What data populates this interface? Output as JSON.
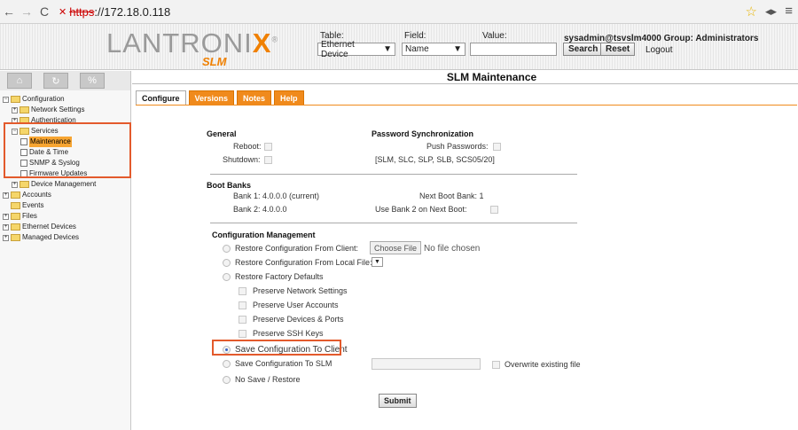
{
  "browser": {
    "scheme": "https",
    "host": "://172.18.0.118"
  },
  "header": {
    "logo_text": "LANTRONI",
    "logo_x": "X",
    "logo_reg": "®",
    "logo_sub": "SLM",
    "table_label": "Table:",
    "table_value": "Ethernet Device",
    "field_label": "Field:",
    "field_value": "Name",
    "value_label": "Value:",
    "search_label": "Search",
    "reset_label": "Reset",
    "user_text": "sysadmin@tsvslm4000   Group: Administrators",
    "logout_label": "Logout"
  },
  "sidebar": {
    "tree": [
      {
        "label": "Configuration",
        "level": 0,
        "type": "folder",
        "pm": "−"
      },
      {
        "label": "Network Settings",
        "level": 1,
        "type": "folder",
        "pm": "+"
      },
      {
        "label": "Authentication",
        "level": 1,
        "type": "folder",
        "pm": "+"
      },
      {
        "label": "Services",
        "level": 1,
        "type": "folder",
        "pm": "−"
      },
      {
        "label": "Maintenance",
        "level": 2,
        "type": "doc",
        "selected": true
      },
      {
        "label": "Date & Time",
        "level": 2,
        "type": "doc"
      },
      {
        "label": "SNMP & Syslog",
        "level": 2,
        "type": "doc"
      },
      {
        "label": "Firmware Updates",
        "level": 2,
        "type": "doc"
      },
      {
        "label": "Device Management",
        "level": 1,
        "type": "folder",
        "pm": "+"
      },
      {
        "label": "Accounts",
        "level": 0,
        "type": "folder",
        "pm": "+"
      },
      {
        "label": "Events",
        "level": 0,
        "type": "folder",
        "pm": ""
      },
      {
        "label": "Files",
        "level": 0,
        "type": "folder",
        "pm": "+"
      },
      {
        "label": "Ethernet Devices",
        "level": 0,
        "type": "folder",
        "pm": "+"
      },
      {
        "label": "Managed Devices",
        "level": 0,
        "type": "folder",
        "pm": "+"
      }
    ]
  },
  "main": {
    "title": "SLM Maintenance",
    "tabs": [
      "Configure",
      "Versions",
      "Notes",
      "Help"
    ],
    "general": {
      "heading": "General",
      "reboot": "Reboot:",
      "shutdown": "Shutdown:"
    },
    "password": {
      "heading": "Password Synchronization",
      "push": "Push Passwords:",
      "list": "[SLM, SLC, SLP, SLB, SCS05/20]"
    },
    "boot": {
      "heading": "Boot Banks",
      "bank1": "Bank 1: 4.0.0.0 (current)",
      "bank2": "Bank 2: 4.0.0.0",
      "next": "Next Boot Bank: 1",
      "use2": "Use Bank 2 on Next Boot:"
    },
    "config": {
      "heading": "Configuration Management",
      "restore_client": "Restore Configuration From Client:",
      "choose_file": "Choose File",
      "no_file": "No file chosen",
      "restore_local": "Restore Configuration From Local File:",
      "restore_factory": "Restore Factory Defaults",
      "preserve_network": "Preserve Network Settings",
      "preserve_users": "Preserve User Accounts",
      "preserve_devices": "Preserve Devices & Ports",
      "preserve_ssh": "Preserve SSH Keys",
      "save_client": "Save Configuration To Client",
      "save_slm": "Save Configuration To SLM",
      "overwrite": "Overwrite existing file",
      "no_save": "No Save / Restore",
      "submit": "Submit"
    }
  },
  "colors": {
    "accent": "#f08a1c",
    "highlight": "#e35a2c"
  }
}
